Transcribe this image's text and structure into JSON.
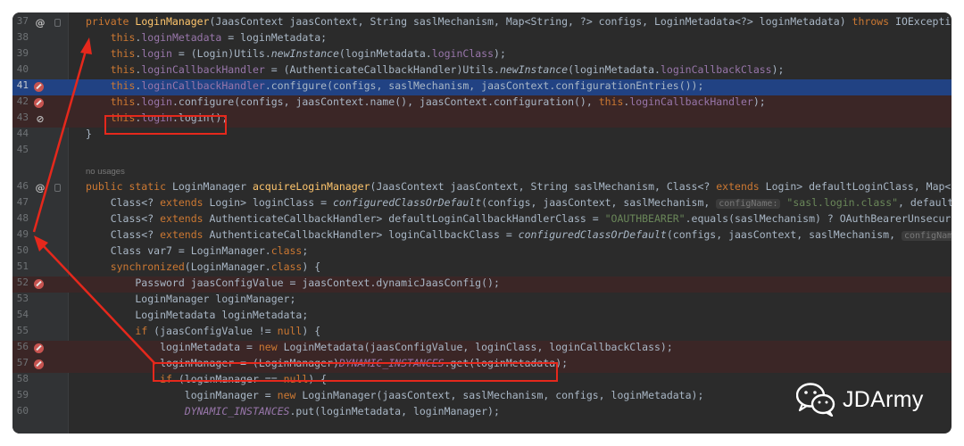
{
  "editor": {
    "lines": [
      {
        "n": "37",
        "icon": "at",
        "tokens": [
          [
            "kw",
            "private "
          ],
          [
            "mth",
            "LoginManager"
          ],
          [
            "p",
            "(JaasContext jaasContext, String saslMechanism, Map<String, ?> configs, LoginMetadata<?> loginMetadata) "
          ],
          [
            "kw",
            "throws "
          ],
          [
            "p",
            "IOException, "
          ]
        ]
      },
      {
        "n": "38",
        "tokens": [
          [
            "p",
            "    "
          ],
          [
            "kw",
            "this"
          ],
          [
            "p",
            "."
          ],
          [
            "fld",
            "loginMetadata"
          ],
          [
            "p",
            " = loginMetadata;"
          ]
        ]
      },
      {
        "n": "39",
        "tokens": [
          [
            "p",
            "    "
          ],
          [
            "kw",
            "this"
          ],
          [
            "p",
            "."
          ],
          [
            "fld",
            "login"
          ],
          [
            "p",
            " = (Login)Utils."
          ],
          [
            "ita",
            "newInstance"
          ],
          [
            "p",
            "(loginMetadata."
          ],
          [
            "fld",
            "loginClass"
          ],
          [
            "p",
            ");"
          ]
        ]
      },
      {
        "n": "40",
        "tokens": [
          [
            "p",
            "    "
          ],
          [
            "kw",
            "this"
          ],
          [
            "p",
            "."
          ],
          [
            "fld",
            "loginCallbackHandler"
          ],
          [
            "p",
            " = (AuthenticateCallbackHandler)Utils."
          ],
          [
            "ita",
            "newInstance"
          ],
          [
            "p",
            "(loginMetadata."
          ],
          [
            "fld",
            "loginCallbackClass"
          ],
          [
            "p",
            ");"
          ]
        ]
      },
      {
        "n": "41",
        "icon": "bp",
        "state": "selected",
        "tokens": [
          [
            "p",
            "    "
          ],
          [
            "kw",
            "this"
          ],
          [
            "p",
            "."
          ],
          [
            "fld",
            "loginCallbackHandler"
          ],
          [
            "p",
            ".configure(configs, saslMechanism, jaasContext.configurationEntries());"
          ]
        ]
      },
      {
        "n": "42",
        "icon": "bp",
        "state": "bp",
        "tokens": [
          [
            "p",
            "    "
          ],
          [
            "kw",
            "this"
          ],
          [
            "p",
            "."
          ],
          [
            "fld",
            "login"
          ],
          [
            "p",
            ".configure(configs, jaasContext.name(), jaasContext.configuration(), "
          ],
          [
            "kw",
            "this"
          ],
          [
            "p",
            "."
          ],
          [
            "fld",
            "loginCallbackHandler"
          ],
          [
            "p",
            ");"
          ]
        ]
      },
      {
        "n": "43",
        "icon": "disabled",
        "state": "bp",
        "tokens": [
          [
            "p",
            "    "
          ],
          [
            "kw",
            "this"
          ],
          [
            "p",
            "."
          ],
          [
            "fld",
            "login"
          ],
          [
            "p",
            ".login();"
          ]
        ]
      },
      {
        "n": "44",
        "tokens": [
          [
            "p",
            "}"
          ]
        ]
      },
      {
        "n": "45",
        "tokens": []
      },
      {
        "n": "46",
        "icon": "at",
        "tokens": [
          [
            "kw",
            "public static "
          ],
          [
            "p",
            "LoginManager "
          ],
          [
            "mth",
            "acquireLoginManager"
          ],
          [
            "p",
            "(JaasContext jaasContext, String saslMechanism, Class<? "
          ],
          [
            "kw",
            "extends "
          ],
          [
            "p",
            "Login> defaultLoginClass, Map<Stri"
          ]
        ]
      },
      {
        "n": "47",
        "tokens": [
          [
            "p",
            "    Class<? "
          ],
          [
            "kw",
            "extends "
          ],
          [
            "p",
            "Login> loginClass = "
          ],
          [
            "ita",
            "configuredClassOrDefault"
          ],
          [
            "p",
            "(configs, jaasContext, saslMechanism, "
          ],
          [
            "hint",
            "configName:"
          ],
          [
            "p",
            " "
          ],
          [
            "str",
            "\"sasl.login.class\""
          ],
          [
            "p",
            ", defaultLogi"
          ]
        ]
      },
      {
        "n": "48",
        "tokens": [
          [
            "p",
            "    Class<? "
          ],
          [
            "kw",
            "extends "
          ],
          [
            "p",
            "AuthenticateCallbackHandler> defaultLoginCallbackHandlerClass = "
          ],
          [
            "str",
            "\"OAUTHBEARER\""
          ],
          [
            "p",
            ".equals(saslMechanism) ? OAuthBearerUnsecuredLo"
          ]
        ]
      },
      {
        "n": "49",
        "tokens": [
          [
            "p",
            "    Class<? "
          ],
          [
            "kw",
            "extends "
          ],
          [
            "p",
            "AuthenticateCallbackHandler> loginCallbackClass = "
          ],
          [
            "ita",
            "configuredClassOrDefault"
          ],
          [
            "p",
            "(configs, jaasContext, saslMechanism, "
          ],
          [
            "hint",
            "configName:"
          ],
          [
            "p",
            " \""
          ]
        ]
      },
      {
        "n": "50",
        "tokens": [
          [
            "p",
            "    Class var7 = LoginManager."
          ],
          [
            "kw",
            "class"
          ],
          [
            "p",
            ";"
          ]
        ]
      },
      {
        "n": "51",
        "tokens": [
          [
            "p",
            "    "
          ],
          [
            "kw",
            "synchronized"
          ],
          [
            "p",
            "(LoginManager."
          ],
          [
            "kw",
            "class"
          ],
          [
            "p",
            ") {"
          ]
        ]
      },
      {
        "n": "52",
        "icon": "bp",
        "state": "bp",
        "tokens": [
          [
            "p",
            "        Password jaasConfigValue = jaasContext.dynamicJaasConfig();"
          ]
        ]
      },
      {
        "n": "53",
        "tokens": [
          [
            "p",
            "        LoginManager loginManager;"
          ]
        ]
      },
      {
        "n": "54",
        "tokens": [
          [
            "p",
            "        LoginMetadata loginMetadata;"
          ]
        ]
      },
      {
        "n": "55",
        "tokens": [
          [
            "p",
            "        "
          ],
          [
            "kw",
            "if "
          ],
          [
            "p",
            "(jaasConfigValue != "
          ],
          [
            "kw",
            "null"
          ],
          [
            "p",
            ") {"
          ]
        ]
      },
      {
        "n": "56",
        "icon": "bp",
        "state": "bp",
        "tokens": [
          [
            "p",
            "            loginMetadata = "
          ],
          [
            "kw",
            "new "
          ],
          [
            "p",
            "LoginMetadata(jaasConfigValue, loginClass, loginCallbackClass);"
          ]
        ]
      },
      {
        "n": "57",
        "icon": "bp",
        "state": "bp",
        "tokens": [
          [
            "p",
            "            loginManager = (LoginManager)"
          ],
          [
            "stat",
            "DYNAMIC_INSTANCES"
          ],
          [
            "p",
            ".get(loginMetadata);"
          ]
        ]
      },
      {
        "n": "58",
        "tokens": [
          [
            "p",
            "            "
          ],
          [
            "kw",
            "if "
          ],
          [
            "p",
            "(loginManager == "
          ],
          [
            "kw",
            "null"
          ],
          [
            "p",
            ") {"
          ]
        ]
      },
      {
        "n": "59",
        "tokens": [
          [
            "p",
            "                loginManager = "
          ],
          [
            "kw",
            "new "
          ],
          [
            "p",
            "LoginManager(jaasContext, saslMechanism, configs, loginMetadata);"
          ]
        ]
      },
      {
        "n": "60",
        "tokens": [
          [
            "p",
            "                "
          ],
          [
            "stat",
            "DYNAMIC_INSTANCES"
          ],
          [
            "p",
            ".put(loginMetadata, loginManager);"
          ]
        ]
      }
    ],
    "no_usages_label": "no usages"
  },
  "watermark": {
    "icon": "wechat-icon",
    "text": "JDArmy"
  },
  "colors": {
    "background": "#2b2b2b",
    "keyword": "#cc7832",
    "field": "#9876aa",
    "method": "#ffc66d",
    "string": "#6a8759",
    "highlight_box": "#e5281c",
    "selected_line": "#214283",
    "breakpoint": "#c75450"
  }
}
